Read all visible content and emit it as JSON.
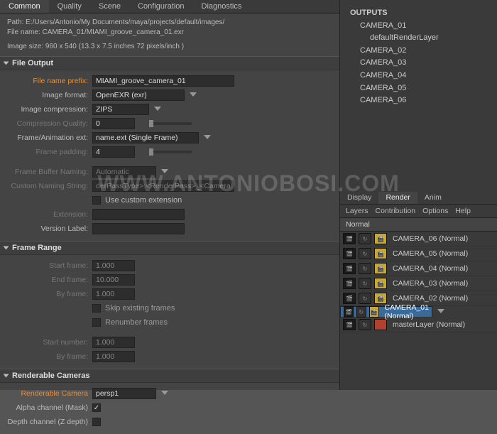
{
  "tabs": [
    "Common",
    "Quality",
    "Scene",
    "Configuration",
    "Diagnostics"
  ],
  "activeTab": 0,
  "info": {
    "pathLabel": "Path:",
    "pathValue": "E:/Users/Antonio/My Documents/maya/projects/default/images/",
    "fileLabel": "File name:",
    "fileValue": "CAMERA_01/MIAMI_groove_camera_01.exr",
    "sizeLine": "Image size: 960 x 540 (13.3 x 7.5 inches 72 pixels/inch )"
  },
  "sections": {
    "fileOutput": "File Output",
    "frameRange": "Frame Range",
    "renderableCameras": "Renderable Cameras"
  },
  "fileOutput": {
    "prefixLabel": "File name prefix:",
    "prefixValue": "MIAMI_groove_camera_01",
    "imageFormatLabel": "Image format:",
    "imageFormatValue": "OpenEXR (exr)",
    "compressionLabel": "Image compression:",
    "compressionValue": "ZIPS",
    "compQualityLabel": "Compression Quality:",
    "compQualityValue": "0",
    "frameExtLabel": "Frame/Animation ext:",
    "frameExtValue": "name.ext (Single Frame)",
    "framePaddingLabel": "Frame padding:",
    "framePaddingValue": "4",
    "frameBufferLabel": "Frame Buffer Naming:",
    "frameBufferValue": "Automatic",
    "customNamingLabel": "Custom Naming String:",
    "customNamingValue": "derPassType>:<RenderPass>_<Camera>",
    "useCustomExt": "Use custom extension",
    "extensionLabel": "Extension:",
    "versionLabel": "Version Label:"
  },
  "frameRange": {
    "startLabel": "Start frame:",
    "startValue": "1.000",
    "endLabel": "End frame:",
    "endValue": "10.000",
    "byLabel": "By frame:",
    "byValue": "1.000",
    "skip": "Skip existing frames",
    "renumber": "Renumber frames",
    "startNumLabel": "Start number:",
    "startNumValue": "1.000",
    "byFrame2Label": "By frame:",
    "byFrame2Value": "1.000"
  },
  "renderableCameras": {
    "cameraLabel": "Renderable Camera",
    "cameraValue": "persp1",
    "alphaLabel": "Alpha channel (Mask)",
    "depthLabel": "Depth channel (Z depth)"
  },
  "outputs": {
    "title": "OUTPUTS",
    "items": [
      "CAMERA_01",
      "defaultRenderLayer",
      "CAMERA_02",
      "CAMERA_03",
      "CAMERA_04",
      "CAMERA_05",
      "CAMERA_06"
    ]
  },
  "rightTabs": [
    "Display",
    "Render",
    "Anim"
  ],
  "rightActive": 1,
  "rightMenu": [
    "Layers",
    "Contribution",
    "Options",
    "Help"
  ],
  "normalLabel": "Normal",
  "layers": [
    {
      "name": "CAMERA_06 (Normal)",
      "sel": false,
      "yel": true
    },
    {
      "name": "CAMERA_05 (Normal)",
      "sel": false,
      "yel": true
    },
    {
      "name": "CAMERA_04 (Normal)",
      "sel": false,
      "yel": true
    },
    {
      "name": "CAMERA_03 (Normal)",
      "sel": false,
      "yel": true
    },
    {
      "name": "CAMERA_02 (Normal)",
      "sel": false,
      "yel": true
    },
    {
      "name": "CAMERA_01 (Normal)",
      "sel": true,
      "yel": true
    },
    {
      "name": "masterLayer (Normal)",
      "sel": false,
      "yel": false
    }
  ],
  "watermark": "WWW.ANTONIOBOSI.COM"
}
